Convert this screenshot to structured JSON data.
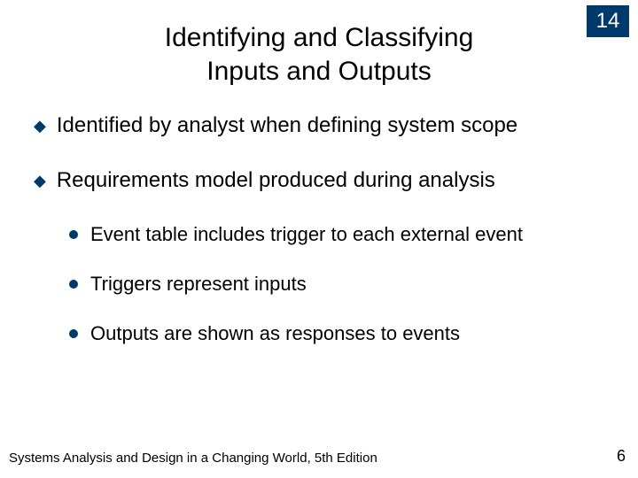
{
  "chapter": "14",
  "title": {
    "line1": "Identifying and Classifying",
    "line2": "Inputs and Outputs"
  },
  "bullets": [
    {
      "text": "Identified by analyst when defining system scope"
    },
    {
      "text": "Requirements model produced during analysis",
      "sub": [
        "Event table includes trigger to each external event",
        "Triggers represent inputs",
        "Outputs are shown as responses to events"
      ]
    }
  ],
  "footer": "Systems Analysis and Design in a Changing World, 5th Edition",
  "page": "6"
}
